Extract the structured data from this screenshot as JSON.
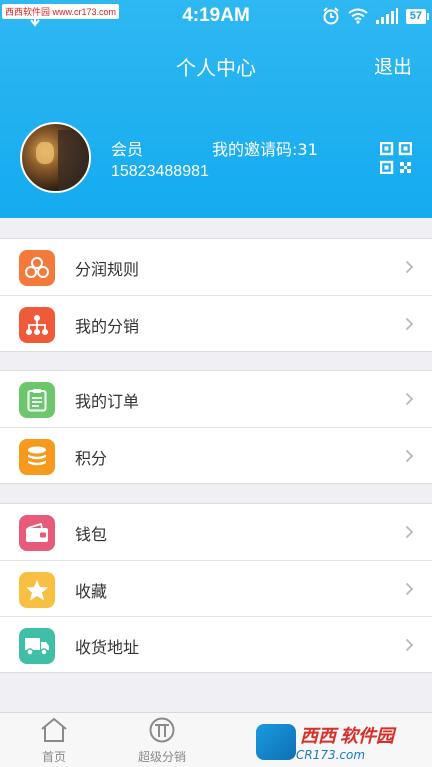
{
  "status_bar": {
    "time": "4:19AM",
    "battery": "57",
    "watermark": "西西软件园 www.cr173.com"
  },
  "header": {
    "title": "个人中心",
    "logout_label": "退出"
  },
  "profile": {
    "member_label": "会员",
    "invite_code": "我的邀请码:31",
    "phone": "15823488981"
  },
  "menu_groups": [
    {
      "items": [
        {
          "label": "分润规则",
          "icon": "coins-icon",
          "color": "#f47a3c"
        },
        {
          "label": "我的分销",
          "icon": "hierarchy-icon",
          "color": "#ef5a3a"
        }
      ]
    },
    {
      "items": [
        {
          "label": "我的订单",
          "icon": "clipboard-icon",
          "color": "#6cc66c"
        },
        {
          "label": "积分",
          "icon": "database-icon",
          "color": "#f59a1c"
        }
      ]
    },
    {
      "items": [
        {
          "label": "钱包",
          "icon": "wallet-icon",
          "color": "#e85a7a"
        },
        {
          "label": "收藏",
          "icon": "star-icon",
          "color": "#f7c042"
        },
        {
          "label": "收货地址",
          "icon": "truck-icon",
          "color": "#3fbfa6"
        }
      ]
    }
  ],
  "tabbar": {
    "tabs": [
      {
        "label": "首页",
        "icon": "home-icon"
      },
      {
        "label": "超级分销",
        "icon": "distribution-icon"
      }
    ]
  },
  "brand_overlay": {
    "text": "西西",
    "text2": "软件园",
    "sub": "CR173.com"
  },
  "colors": {
    "header_blue": "#14abef",
    "background": "#efeff4"
  }
}
